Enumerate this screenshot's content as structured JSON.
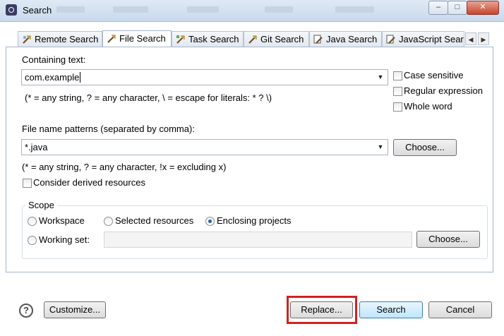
{
  "window": {
    "title": "Search",
    "minimize": "–",
    "maximize": "□",
    "close": "✕"
  },
  "tabs": [
    {
      "label": "Remote Search",
      "icon": "remote-search-icon"
    },
    {
      "label": "File Search",
      "icon": "file-search-icon",
      "active": true
    },
    {
      "label": "Task Search",
      "icon": "task-search-icon"
    },
    {
      "label": "Git Search",
      "icon": "git-search-icon"
    },
    {
      "label": "Java Search",
      "icon": "java-search-icon"
    },
    {
      "label": "JavaScript Search",
      "icon": "javascript-search-icon"
    }
  ],
  "tab_scroll": {
    "left": "◀",
    "right": "▶"
  },
  "containing_text": {
    "label": "Containing text:",
    "value": "com.example",
    "hint": "(* = any string, ? = any character, \\ = escape for literals: * ? \\)"
  },
  "options": {
    "case_sensitive": "Case sensitive",
    "regular_expression": "Regular expression",
    "whole_word": "Whole word"
  },
  "file_patterns": {
    "label": "File name patterns (separated by comma):",
    "value": "*.java",
    "choose": "Choose...",
    "hint": "(* = any string, ? = any character, !x = excluding x)"
  },
  "derived": {
    "label": "Consider derived resources"
  },
  "scope": {
    "title": "Scope",
    "workspace": "Workspace",
    "selected_resources": "Selected resources",
    "enclosing_projects": "Enclosing projects",
    "selected": "enclosing_projects",
    "working_set": "Working set:",
    "working_set_value": "",
    "choose": "Choose..."
  },
  "footer": {
    "help": "?",
    "customize": "Customize...",
    "replace": "Replace...",
    "search": "Search",
    "cancel": "Cancel"
  },
  "colors": {
    "titlebar": "#c9d9ed",
    "highlight": "#d42020",
    "default_button": "#bee6fd"
  }
}
